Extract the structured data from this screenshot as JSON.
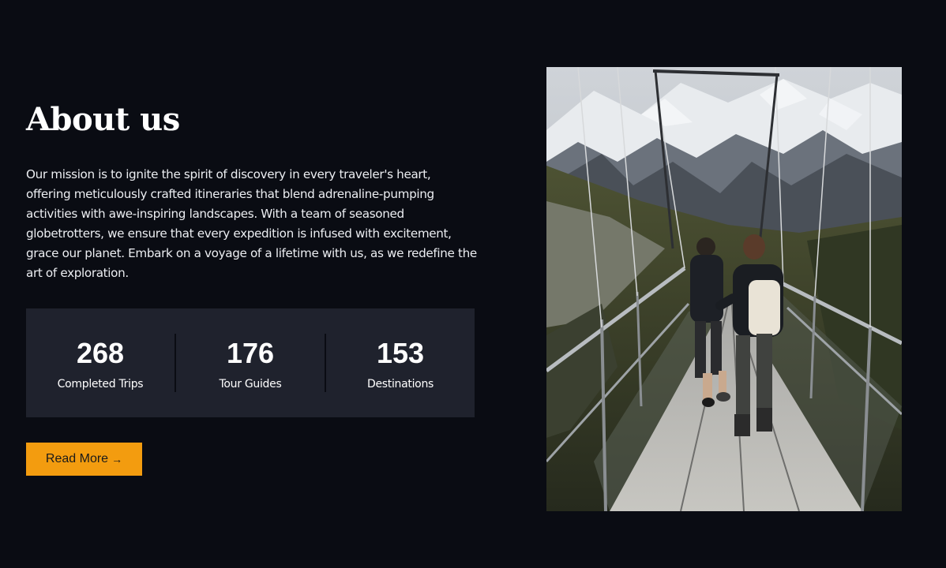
{
  "about": {
    "title": "About us",
    "mission": "Our mission is to ignite the spirit of discovery in every traveler's heart, offering meticulously crafted itineraries that blend adrenaline-pumping activities with awe-inspiring landscapes. With a team of seasoned globetrotters, we ensure that every expedition is infused with excitement, grace our planet. Embark on a voyage of a lifetime with us, as we redefine the art of exploration."
  },
  "stats": [
    {
      "number": "268",
      "label": "Completed Trips"
    },
    {
      "number": "176",
      "label": "Tour Guides"
    },
    {
      "number": "153",
      "label": "Destinations"
    }
  ],
  "read_more": {
    "label": "Read More",
    "icon": "arrow-right-icon",
    "icon_glyph": "→"
  },
  "colors": {
    "background": "#0a0c13",
    "stats_panel": "#1f222d",
    "accent": "#f39c0f"
  }
}
